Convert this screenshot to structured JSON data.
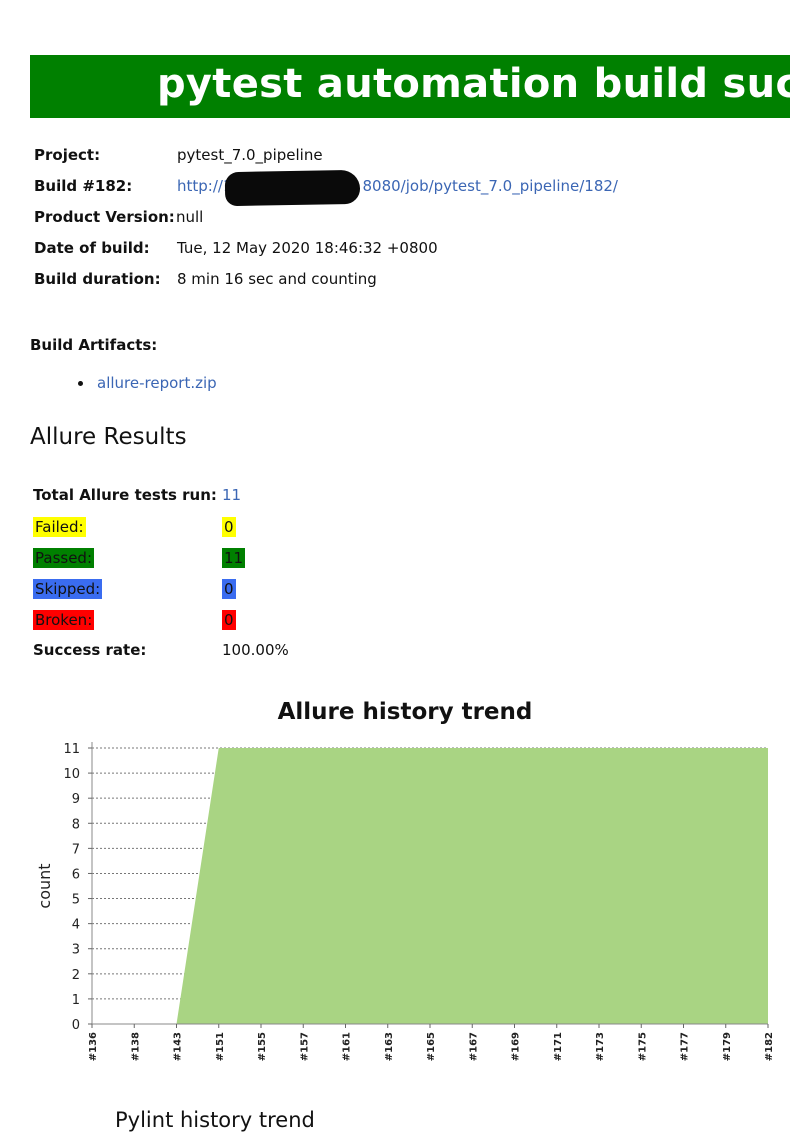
{
  "banner": {
    "title": "pytest automation build success"
  },
  "build_info": {
    "project_label": "Project:",
    "project_value": "pytest_7.0_pipeline",
    "build_label": "Build #182:",
    "build_link_prefix": "http://1",
    "build_link_suffix": "8080/job/pytest_7.0_pipeline/182/",
    "product_version_label": "Product Version:",
    "product_version_value": "null",
    "date_label": "Date of build:",
    "date_value": "Tue, 12 May 2020 18:46:32 +0800",
    "duration_label": "Build duration:",
    "duration_value": "8 min 16 sec and counting"
  },
  "artifacts": {
    "label": "Build Artifacts:",
    "items": [
      "allure-report.zip"
    ]
  },
  "allure": {
    "heading": "Allure Results",
    "total_label": "Total Allure tests run:",
    "total_value": "11",
    "failed_label": "Failed:",
    "failed_value": "0",
    "passed_label": "Passed:",
    "passed_value": "11",
    "skipped_label": "Skipped:",
    "skipped_value": "0",
    "broken_label": "Broken:",
    "broken_value": "0",
    "success_label": "Success rate:",
    "success_value": "100.00%"
  },
  "chart_data": {
    "type": "area",
    "title": "Allure history trend",
    "ylabel": "count",
    "xlabel": "",
    "categories": [
      "#136",
      "#138",
      "#143",
      "#151",
      "#155",
      "#157",
      "#161",
      "#163",
      "#165",
      "#167",
      "#169",
      "#171",
      "#173",
      "#175",
      "#177",
      "#179",
      "#182"
    ],
    "values": [
      0,
      0,
      0,
      11,
      11,
      11,
      11,
      11,
      11,
      11,
      11,
      11,
      11,
      11,
      11,
      11,
      11
    ],
    "ylim": [
      0,
      11
    ],
    "yticks": [
      0,
      1,
      2,
      3,
      4,
      5,
      6,
      7,
      8,
      9,
      10,
      11
    ],
    "grid": true,
    "fill_color": "#a9d483"
  },
  "pylint": {
    "heading": "Pylint history trend"
  }
}
